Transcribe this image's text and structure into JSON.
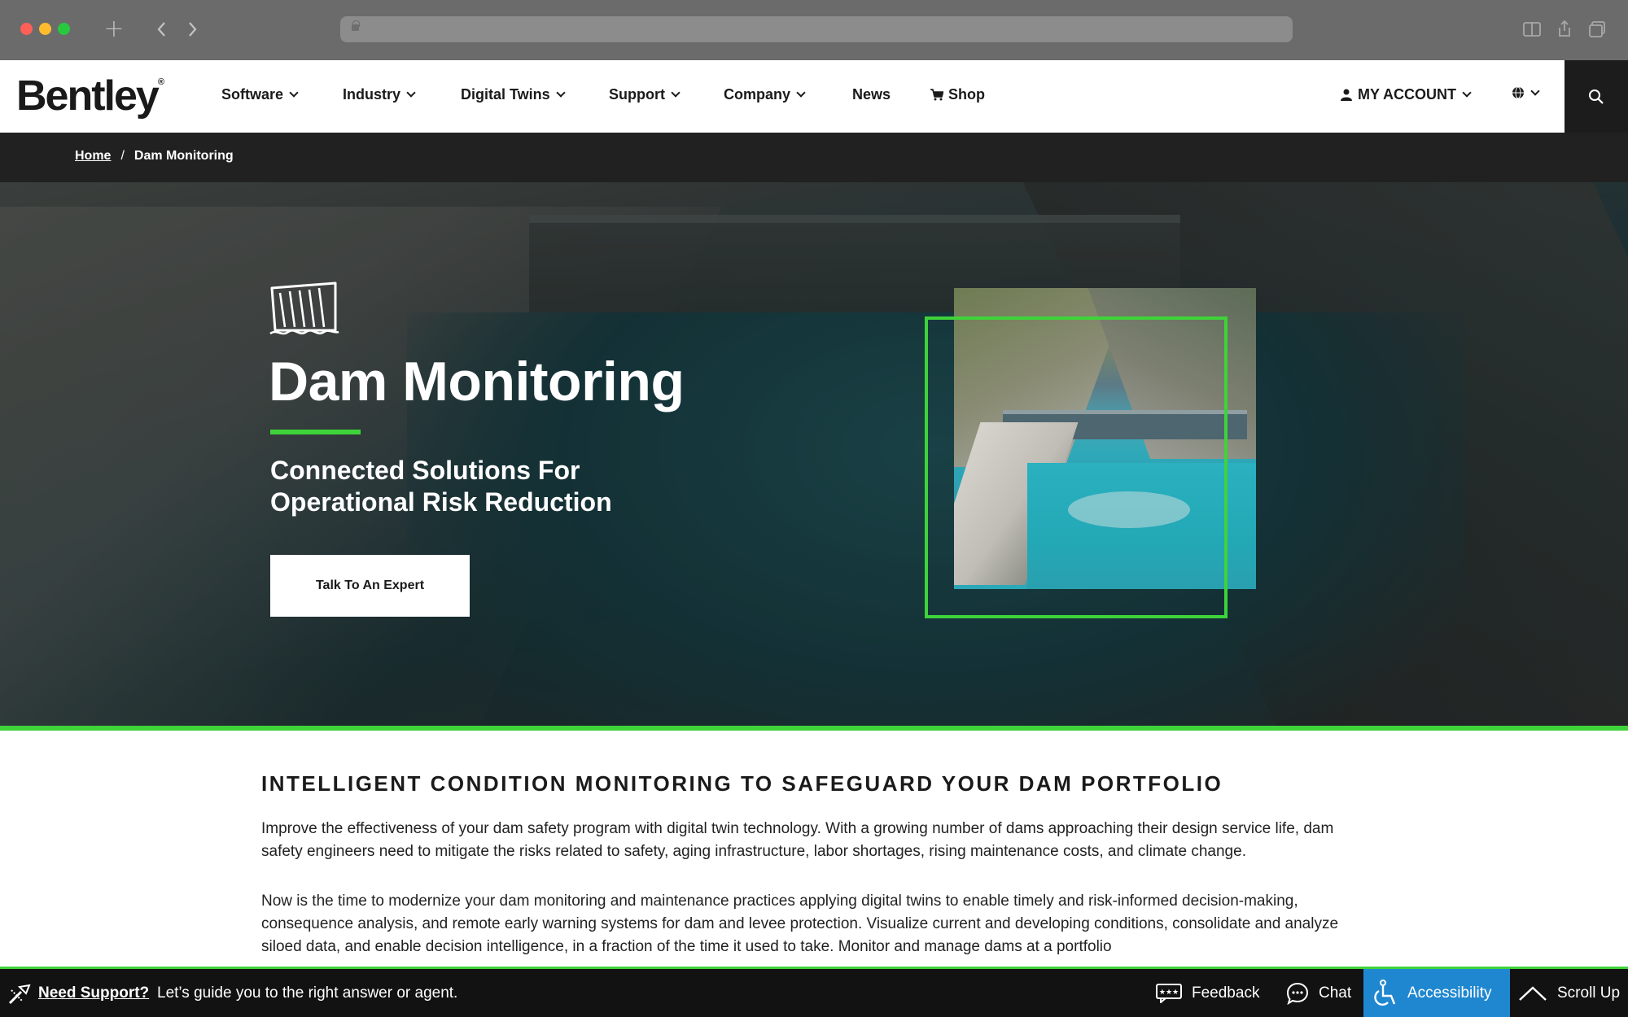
{
  "browser": {
    "new_tab_glyph": "+",
    "back_glyph": "‹",
    "forward_glyph": "›"
  },
  "nav": {
    "logo": "Bentley",
    "logo_mark": "®",
    "items": [
      {
        "label": "Software"
      },
      {
        "label": "Industry"
      },
      {
        "label": "Digital Twins"
      },
      {
        "label": "Support"
      },
      {
        "label": "Company"
      },
      {
        "label": "News"
      },
      {
        "label": "Shop"
      }
    ],
    "account_label": "MY ACCOUNT"
  },
  "breadcrumb": {
    "home": "Home",
    "separator": "/",
    "current": "Dam Monitoring"
  },
  "hero": {
    "title": "Dam Monitoring",
    "subtitle": "Connected Solutions For Operational Risk Reduction",
    "cta_label": "Talk To An Expert",
    "accent_color": "#3fd33a"
  },
  "content": {
    "section_title": "INTELLIGENT CONDITION MONITORING TO SAFEGUARD YOUR DAM PORTFOLIO",
    "paragraphs": [
      "Improve the effectiveness of your dam safety program with digital twin technology. With a growing number of dams approaching their design service life, dam safety engineers need to mitigate the risks related to safety, aging infrastructure, labor shortages, rising maintenance costs, and climate change.",
      "Now is the time to modernize your dam monitoring and maintenance practices applying digital twins to enable timely and risk-informed decision-making, consequence analysis, and remote early warning systems for dam and levee protection. Visualize current and developing conditions, consolidate and analyze siloed data, and enable decision intelligence, in a fraction of the time it used to take. Monitor and manage dams at a portfolio"
    ]
  },
  "support_bar": {
    "need_support": "Need Support?",
    "guide_text": "Let’s guide you to the right answer or agent.",
    "feedback": "Feedback",
    "chat": "Chat",
    "accessibility": "Accessibility",
    "scroll_up": "Scroll Up",
    "accessibility_color": "#1f87d0"
  }
}
